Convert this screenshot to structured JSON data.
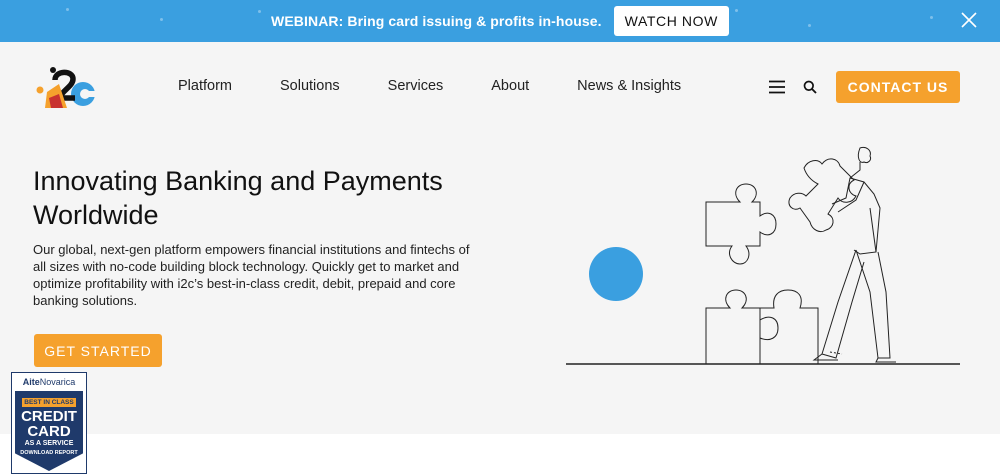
{
  "banner": {
    "text": "WEBINAR: Bring card issuing & profits in-house.",
    "button_label": "WATCH NOW",
    "bg_color": "#3a9fe0"
  },
  "nav": {
    "items": [
      {
        "label": "Platform"
      },
      {
        "label": "Solutions"
      },
      {
        "label": "Services"
      },
      {
        "label": "About"
      },
      {
        "label": "News & Insights"
      }
    ],
    "icons": [
      "menu-icon",
      "search-icon"
    ],
    "contact_label": "CONTACT US"
  },
  "hero": {
    "title": "Innovating Banking and Payments Worldwide",
    "description": "Our global, next-gen platform empowers financial institutions and fintechs of all sizes with no-code building block technology. Quickly get to market and optimize profitability with i2c’s best-in-class credit, debit, prepaid and core banking solutions.",
    "cta_label": "GET STARTED"
  },
  "badge": {
    "brand_bold": "Aite",
    "brand_rest": "Novarica",
    "ribbon": "BEST IN CLASS",
    "line1": "CREDIT",
    "line2": "CARD",
    "line3": "AS A SERVICE",
    "cta": "DOWNLOAD REPORT"
  },
  "colors": {
    "accent": "#f5a12d",
    "primary_blue": "#3a9fe0",
    "navy": "#1f3a6b",
    "hero_bg": "#f5f5f5"
  }
}
